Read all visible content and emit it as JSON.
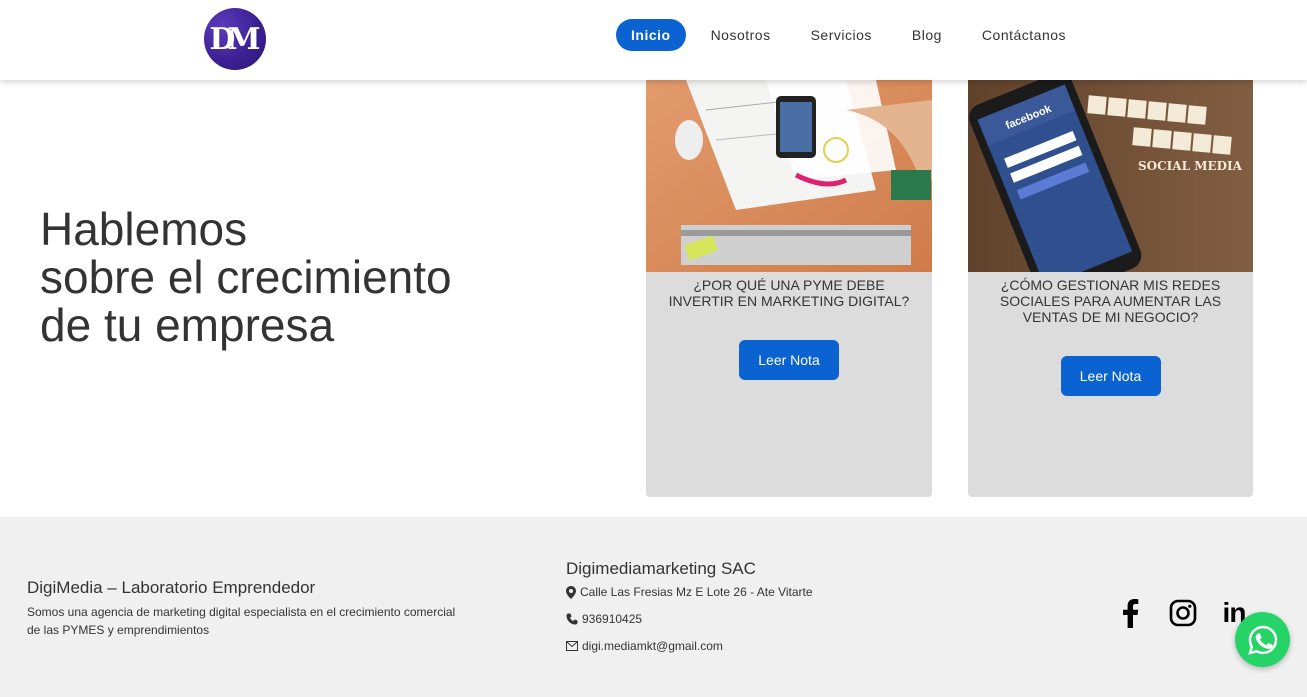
{
  "header": {
    "logo_alt": "DM",
    "nav": [
      {
        "label": "Inicio",
        "active": true
      },
      {
        "label": "Nosotros",
        "active": false
      },
      {
        "label": "Servicios",
        "active": false
      },
      {
        "label": "Blog",
        "active": false
      },
      {
        "label": "Contáctanos",
        "active": false
      }
    ]
  },
  "hero": {
    "line1": "Hablemos",
    "line2": "sobre el crecimiento",
    "line3": "de tu empresa"
  },
  "cards": [
    {
      "title": "¿POR QUÉ UNA PYME DEBE INVERTIR EN MARKETING DIGITAL?",
      "button": "Leer Nota",
      "image": "desk-workspace-photo"
    },
    {
      "title": "¿CÓMO GESTIONAR MIS REDES SOCIALES PARA AUMENTAR LAS VENTAS DE MI NEGOCIO?",
      "button": "Leer Nota",
      "image": "facebook-phone-social-media-photo"
    }
  ],
  "card2_image_letters": "SOCIAL MEDIA",
  "card2_phone_text": "facebook",
  "footer": {
    "brand": "DigiMedia – Laboratorio Emprendedor",
    "description": "Somos una agencia de marketing digital especialista en el crecimiento comercial de las PYMES y emprendimientos",
    "company": "Digimediamarketing SAC",
    "address": "Calle Las Fresias Mz E Lote 26 - Ate Vitarte",
    "phone": "936910425",
    "email": "digi.mediamkt@gmail.com",
    "social": [
      "facebook-icon",
      "instagram-icon",
      "linkedin-icon"
    ],
    "linkedin_text": "in"
  },
  "colors": {
    "primary": "#0a63d1",
    "whatsapp": "#25d366",
    "footer_bg": "#f0f0f0",
    "card_bg": "#dcdcdc"
  }
}
